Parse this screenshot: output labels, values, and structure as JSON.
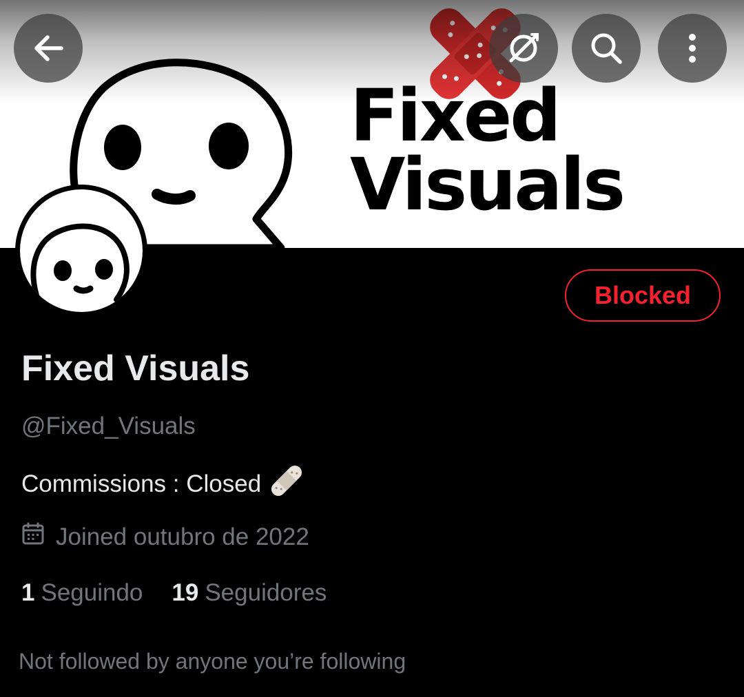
{
  "banner": {
    "title_line1": "Fixed",
    "title_line2": "Visuals"
  },
  "topbar": {
    "back_icon": "arrow-left-icon",
    "grok_icon": "grok-icon",
    "search_icon": "search-icon",
    "more_icon": "more-vertical-icon"
  },
  "profile": {
    "display_name": "Fixed Visuals",
    "handle": "@Fixed_Visuals",
    "bio": "Commissions : Closed",
    "bio_emoji": "adhesive-bandage-icon",
    "joined": "Joined outubro de 2022",
    "following_count": "1",
    "following_label": "Seguindo",
    "followers_count": "19",
    "followers_label": "Seguidores",
    "not_followed_note": "Not followed by anyone you’re following"
  },
  "actions": {
    "blocked_label": "Blocked"
  },
  "colors": {
    "background": "#000000",
    "primary_text": "#e7e9ea",
    "secondary_text": "#71767b",
    "blocked_red": "#f4212e"
  }
}
